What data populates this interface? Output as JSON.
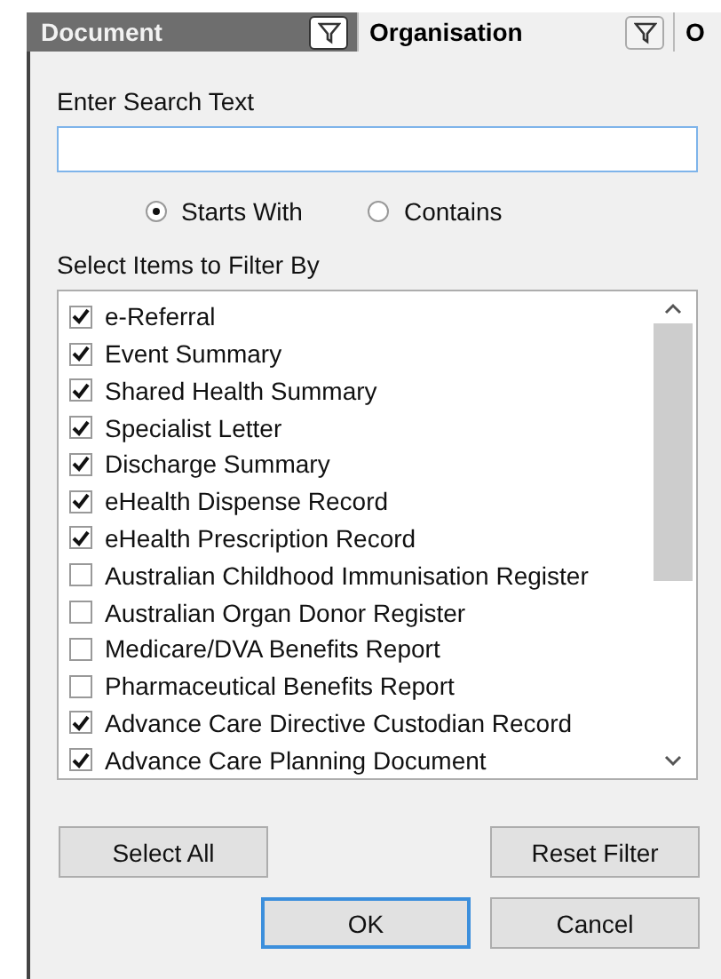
{
  "columns": [
    {
      "label": "Document",
      "active": true,
      "filter": true
    },
    {
      "label": "Organisation",
      "active": false,
      "filter": true
    },
    {
      "label": "O",
      "active": false,
      "filter": false
    }
  ],
  "search": {
    "label": "Enter Search Text"
  },
  "match_modes": [
    {
      "label": "Starts With",
      "selected": true
    },
    {
      "label": "Contains",
      "selected": false
    }
  ],
  "items_label": "Select Items to Filter By",
  "items": [
    {
      "label": "e-Referral",
      "checked": true
    },
    {
      "label": "Event Summary",
      "checked": true
    },
    {
      "label": "Shared Health Summary",
      "checked": true
    },
    {
      "label": "Specialist Letter",
      "checked": true
    },
    {
      "label": "Discharge Summary",
      "checked": true
    },
    {
      "label": "eHealth Dispense Record",
      "checked": true
    },
    {
      "label": "eHealth Prescription Record",
      "checked": true
    },
    {
      "label": "Australian Childhood Immunisation Register",
      "checked": false
    },
    {
      "label": "Australian Organ Donor Register",
      "checked": false
    },
    {
      "label": "Medicare/DVA Benefits Report",
      "checked": false
    },
    {
      "label": "Pharmaceutical Benefits Report",
      "checked": false
    },
    {
      "label": "Advance Care Directive Custodian Record",
      "checked": true
    },
    {
      "label": "Advance Care Planning Document",
      "checked": true
    }
  ],
  "buttons": [
    {
      "label": "Select All",
      "default": false
    },
    {
      "label": "Reset Filter",
      "default": false
    },
    {
      "label": "OK",
      "default": true
    },
    {
      "label": "Cancel",
      "default": false
    }
  ]
}
